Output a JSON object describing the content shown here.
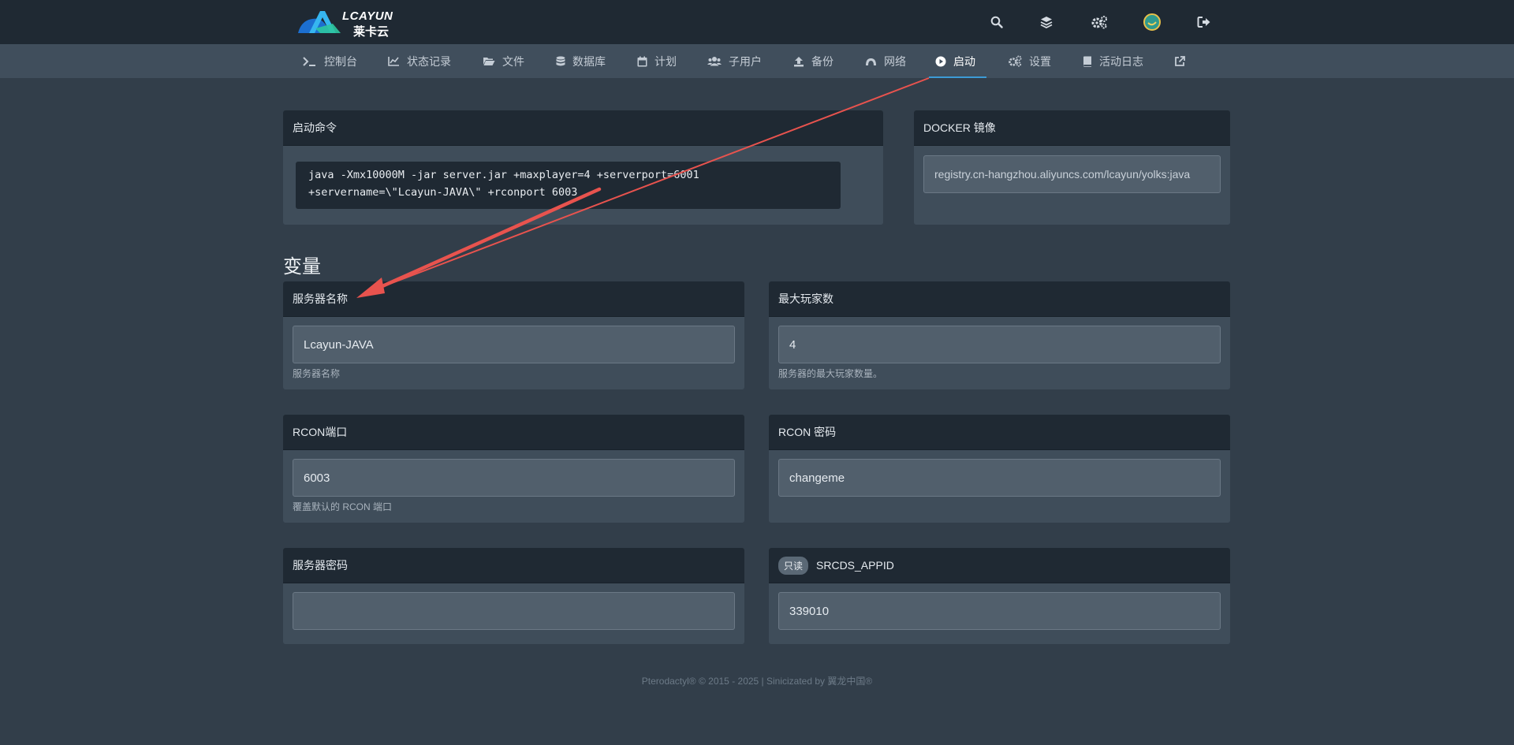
{
  "brand": {
    "line1": "LCAYUN",
    "line2": "莱卡云"
  },
  "nav": {
    "console": "控制台",
    "stats": "状态记录",
    "files": "文件",
    "databases": "数据库",
    "schedules": "计划",
    "users": "子用户",
    "backups": "备份",
    "network": "网络",
    "startup": "启动",
    "settings": "设置",
    "activity": "活动日志"
  },
  "startup": {
    "title": "启动命令",
    "command_line1": "java -Xmx10000M -jar server.jar +maxplayer=4 +serverport=6001",
    "command_line2": "+servername=\\\"Lcayun-JAVA\\\" +rconport 6003"
  },
  "docker": {
    "title": "DOCKER 镜像",
    "image": "registry.cn-hangzhou.aliyuncs.com/lcayun/yolks:java"
  },
  "variables": {
    "heading": "变量",
    "server_name": {
      "label": "服务器名称",
      "value": "Lcayun-JAVA",
      "hint": "服务器名称"
    },
    "max_players": {
      "label": "最大玩家数",
      "value": "4",
      "hint": "服务器的最大玩家数量。"
    },
    "rcon_port": {
      "label": "RCON端口",
      "value": "6003",
      "hint": "覆盖默认的 RCON 端口"
    },
    "rcon_password": {
      "label": "RCON 密码",
      "value": "changeme"
    },
    "server_password": {
      "label": "服务器密码",
      "value": ""
    },
    "srcds_appid": {
      "badge": "只读",
      "label": "SRCDS_APPID",
      "value": "339010"
    }
  },
  "footer": "Pterodactyl® © 2015 - 2025 | Sinicizated by 翼龙中国®",
  "colors": {
    "accent": "#3c9ad6",
    "annotation_arrow": "#e8534e"
  }
}
